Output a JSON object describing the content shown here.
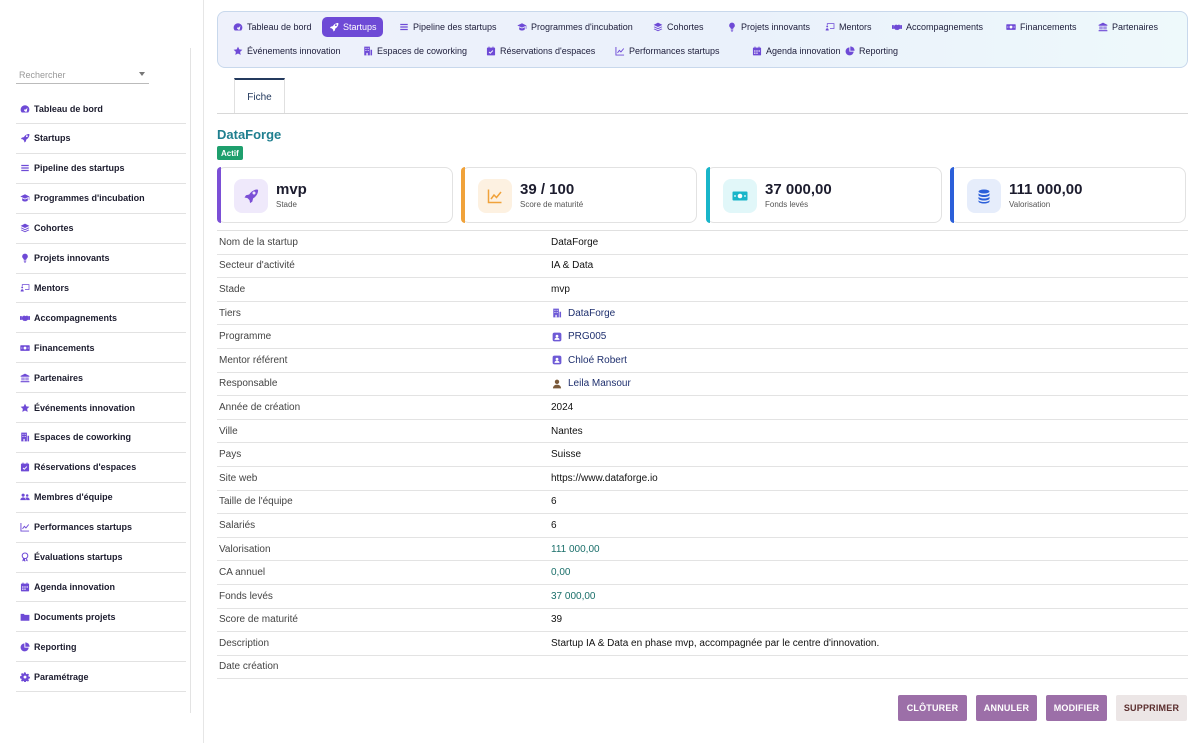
{
  "sidebar": {
    "search_placeholder": "Rechercher",
    "items": [
      {
        "label": "Tableau de bord",
        "icon": "gauge-icon"
      },
      {
        "label": "Startups",
        "icon": "rocket-icon"
      },
      {
        "label": "Pipeline des startups",
        "icon": "bars-icon"
      },
      {
        "label": "Programmes d'incubation",
        "icon": "graduation-cap-icon"
      },
      {
        "label": "Cohortes",
        "icon": "layers-icon"
      },
      {
        "label": "Projets innovants",
        "icon": "lightbulb-icon"
      },
      {
        "label": "Mentors",
        "icon": "chalkboard-icon"
      },
      {
        "label": "Accompagnements",
        "icon": "handshake-icon"
      },
      {
        "label": "Financements",
        "icon": "money-icon"
      },
      {
        "label": "Partenaires",
        "icon": "bank-icon"
      },
      {
        "label": "Événements innovation",
        "icon": "star-icon"
      },
      {
        "label": "Espaces de coworking",
        "icon": "building-icon"
      },
      {
        "label": "Réservations d'espaces",
        "icon": "calendar-check-icon"
      },
      {
        "label": "Membres d'équipe",
        "icon": "users-icon"
      },
      {
        "label": "Performances startups",
        "icon": "line-chart-icon"
      },
      {
        "label": "Évaluations startups",
        "icon": "award-icon"
      },
      {
        "label": "Agenda innovation",
        "icon": "calendar-icon"
      },
      {
        "label": "Documents projets",
        "icon": "folder-icon"
      },
      {
        "label": "Reporting",
        "icon": "pie-chart-icon"
      },
      {
        "label": "Paramétrage",
        "icon": "gear-icon"
      }
    ]
  },
  "topnav": {
    "row1": [
      {
        "label": "Tableau de bord",
        "icon": "gauge-icon"
      },
      {
        "label": "Startups",
        "icon": "rocket-icon",
        "active": true
      },
      {
        "label": "Pipeline des startups",
        "icon": "bars-icon"
      },
      {
        "label": "Programmes d'incubation",
        "icon": "graduation-cap-icon"
      },
      {
        "label": "Cohortes",
        "icon": "layers-icon"
      },
      {
        "label": "Projets innovants",
        "icon": "lightbulb-icon"
      },
      {
        "label": "Mentors",
        "icon": "chalkboard-icon"
      },
      {
        "label": "Accompagnements",
        "icon": "handshake-icon"
      },
      {
        "label": "Financements",
        "icon": "money-icon"
      },
      {
        "label": "Partenaires",
        "icon": "bank-icon"
      }
    ],
    "row2": [
      {
        "label": "Événements innovation",
        "icon": "star-icon"
      },
      {
        "label": "Espaces de coworking",
        "icon": "building-icon"
      },
      {
        "label": "Réservations d'espaces",
        "icon": "calendar-check-icon"
      },
      {
        "label": "Performances startups",
        "icon": "line-chart-icon"
      },
      {
        "label": "Agenda innovation",
        "icon": "calendar-icon"
      },
      {
        "label": "Reporting",
        "icon": "pie-chart-icon"
      }
    ]
  },
  "tabs": {
    "fiche": "Fiche"
  },
  "record": {
    "title": "DataForge",
    "status": "Actif"
  },
  "kpis": [
    {
      "value": "mvp",
      "label": "Stade",
      "icon": "rocket-icon",
      "accent": "#7b4fd6"
    },
    {
      "value": "39 / 100",
      "label": "Score de maturité",
      "icon": "line-chart-icon",
      "accent": "#f0a23a"
    },
    {
      "value": "37 000,00",
      "label": "Fonds levés",
      "icon": "money-icon",
      "accent": "#19b5c9"
    },
    {
      "value": "111 000,00",
      "label": "Valorisation",
      "icon": "coins-icon",
      "accent": "#2b5fd9"
    }
  ],
  "fields": [
    {
      "key": "Nom de la startup",
      "value": "DataForge"
    },
    {
      "key": "Secteur d'activité",
      "value": "IA & Data"
    },
    {
      "key": "Stade",
      "value": "mvp"
    },
    {
      "key": "Tiers",
      "value": "DataForge",
      "icon": "building-icon"
    },
    {
      "key": "Programme",
      "value": "PRG005",
      "icon": "badge-icon"
    },
    {
      "key": "Mentor référent",
      "value": "Chloé Robert",
      "icon": "badge-icon"
    },
    {
      "key": "Responsable",
      "value": "Leila Mansour",
      "icon": "user-icon"
    },
    {
      "key": "Année de création",
      "value": "2024"
    },
    {
      "key": "Ville",
      "value": "Nantes"
    },
    {
      "key": "Pays",
      "value": "Suisse"
    },
    {
      "key": "Site web",
      "value": "https://www.dataforge.io"
    },
    {
      "key": "Taille de l'équipe",
      "value": "6"
    },
    {
      "key": "Salariés",
      "value": "6"
    },
    {
      "key": "Valorisation",
      "value": "111 000,00"
    },
    {
      "key": "CA annuel",
      "value": "0,00"
    },
    {
      "key": "Fonds levés",
      "value": "37 000,00"
    },
    {
      "key": "Score de maturité",
      "value": "39"
    },
    {
      "key": "Description",
      "value": "Startup IA & Data en phase mvp, accompagnée par le centre d'innovation."
    },
    {
      "key": "Date création",
      "value": ""
    }
  ],
  "actions": {
    "cloturer": "CLÔTURER",
    "annuler": "ANNULER",
    "modifier": "MODIFIER",
    "supprimer": "SUPPRIMER"
  },
  "colors": {
    "accent": "#6e4ad6",
    "brand_teal": "#1f7f8f",
    "status_green": "#1e9f6d"
  }
}
